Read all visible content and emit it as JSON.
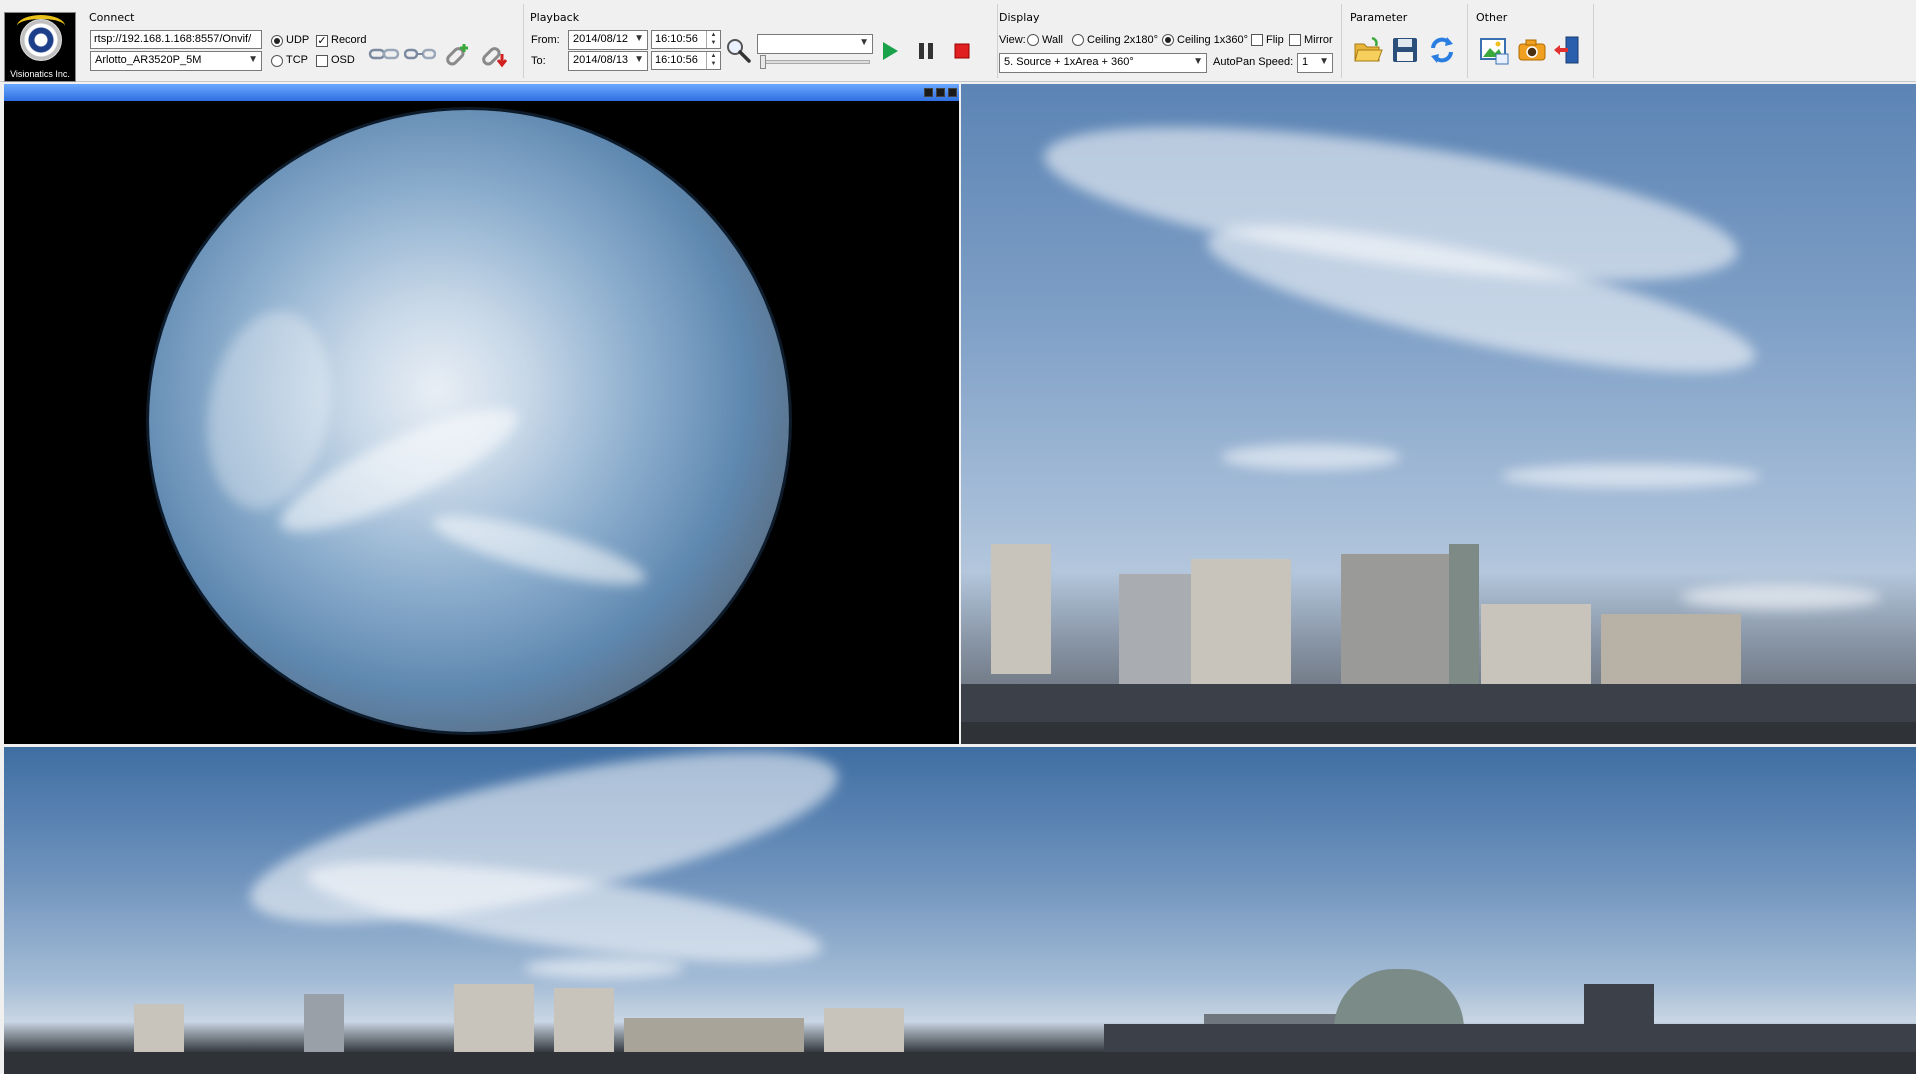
{
  "connect": {
    "title": "Connect",
    "brand": "Visionatics Inc.",
    "url_value": "rtsp://192.168.1.168:8557/Onvif/",
    "camera_model": "Arlotto_AR3520P_5M",
    "udp_label": "UDP",
    "tcp_label": "TCP",
    "record_label": "Record",
    "osd_label": "OSD",
    "udp_selected": true,
    "record_checked": true,
    "osd_checked": false
  },
  "playback": {
    "title": "Playback",
    "from_label": "From:",
    "to_label": "To:",
    "from_date": "2014/08/12",
    "from_time": "16:10:56",
    "to_date": "2014/08/13",
    "to_time": "16:10:56",
    "file_select_value": ""
  },
  "display": {
    "title": "Display",
    "view_label": "View:",
    "wall_label": "Wall",
    "ceiling_2x180_label": "Ceiling 2x180°",
    "ceiling_1x360_label": "Ceiling 1x360°",
    "flip_label": "Flip",
    "mirror_label": "Mirror",
    "mode_value": "5. Source + 1xArea + 360°",
    "autopan_label": "AutoPan Speed:",
    "autopan_value": "1",
    "selected_view": "ceiling_1x360"
  },
  "parameter": {
    "title": "Parameter"
  },
  "other": {
    "title": "Other"
  },
  "icons": {
    "connect_a": "chain-link-icon",
    "connect_b": "chain-link-icon",
    "connect_c": "link-add-icon",
    "connect_d": "link-remove-icon",
    "search": "magnifier-icon",
    "play": "play-icon",
    "pause": "pause-icon",
    "stop": "stop-icon",
    "open": "folder-open-icon",
    "save": "floppy-save-icon",
    "refresh": "refresh-icon",
    "image": "image-export-icon",
    "snapshot": "camera-icon",
    "exit": "exit-door-icon"
  },
  "colors": {
    "play": "#1aa24a",
    "stop": "#e02020",
    "titlebar": "#3a7cf0"
  }
}
